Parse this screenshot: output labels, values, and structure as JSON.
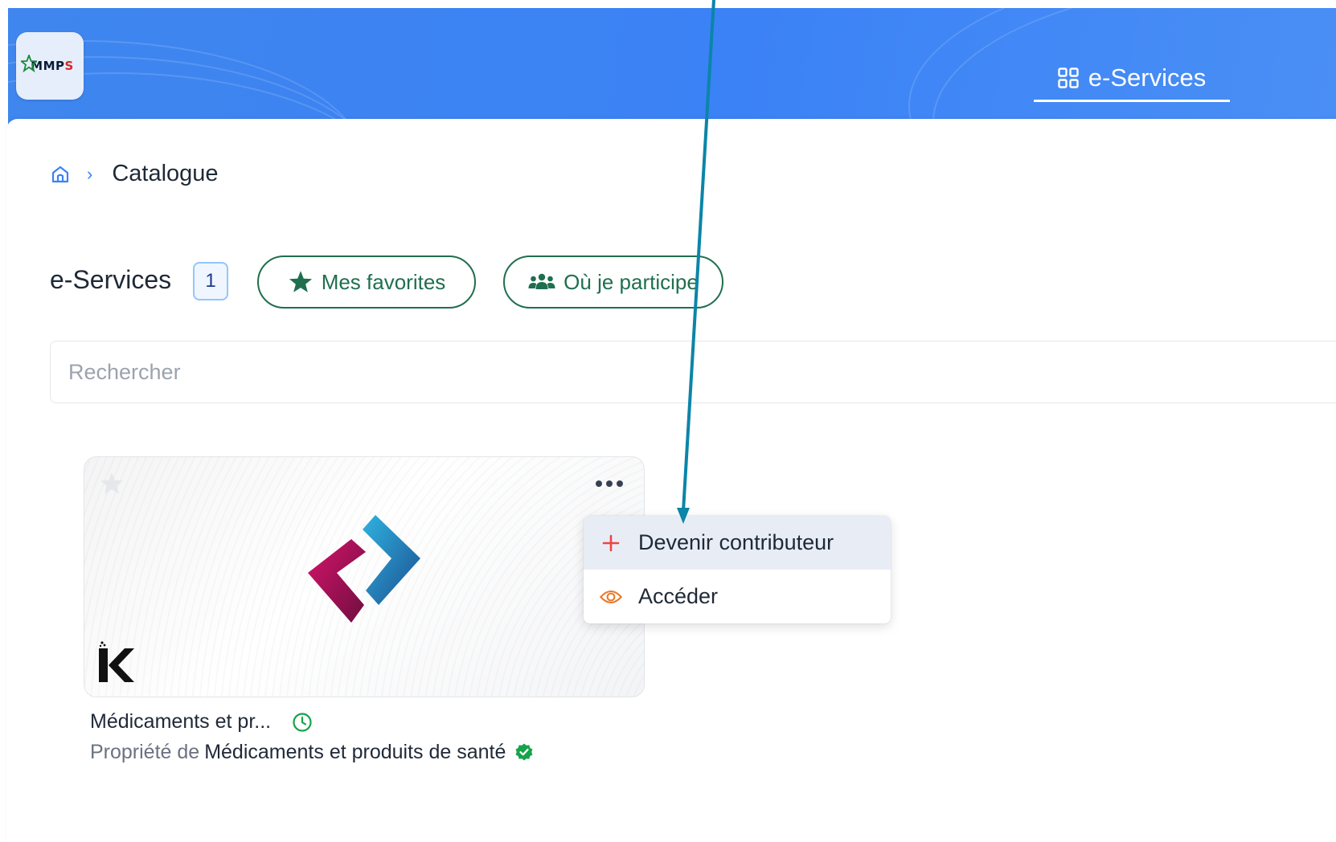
{
  "app": {
    "logo_text_main": "MMP",
    "logo_text_accent": "S",
    "nav_tab_label": "e-Services"
  },
  "breadcrumb": {
    "current": "Catalogue"
  },
  "catalog": {
    "title": "e-Services",
    "count": "1",
    "filters": {
      "favorites_label": "Mes favorites",
      "participate_label": "Où je participe"
    },
    "search": {
      "placeholder": "Rechercher",
      "value": ""
    }
  },
  "card": {
    "title": "Médicaments et pr...",
    "owner_prefix": "Propriété de",
    "owner_name": "Médicaments et produits de santé",
    "favorited": false,
    "status_icon": "clock-icon",
    "owner_badge_icon": "verified-check-icon"
  },
  "dropdown": {
    "items": [
      {
        "label": "Devenir contributeur",
        "icon": "plus-icon",
        "highlighted": true
      },
      {
        "label": "Accéder",
        "icon": "eye-icon",
        "highlighted": false
      }
    ]
  },
  "colors": {
    "primary_blue": "#3b82f6",
    "pill_green": "#1f6f4e",
    "status_green": "#16a34a",
    "plus_red": "#ef4444",
    "eye_orange": "#ea7a2d",
    "annotation_arrow": "#0b85a8"
  }
}
